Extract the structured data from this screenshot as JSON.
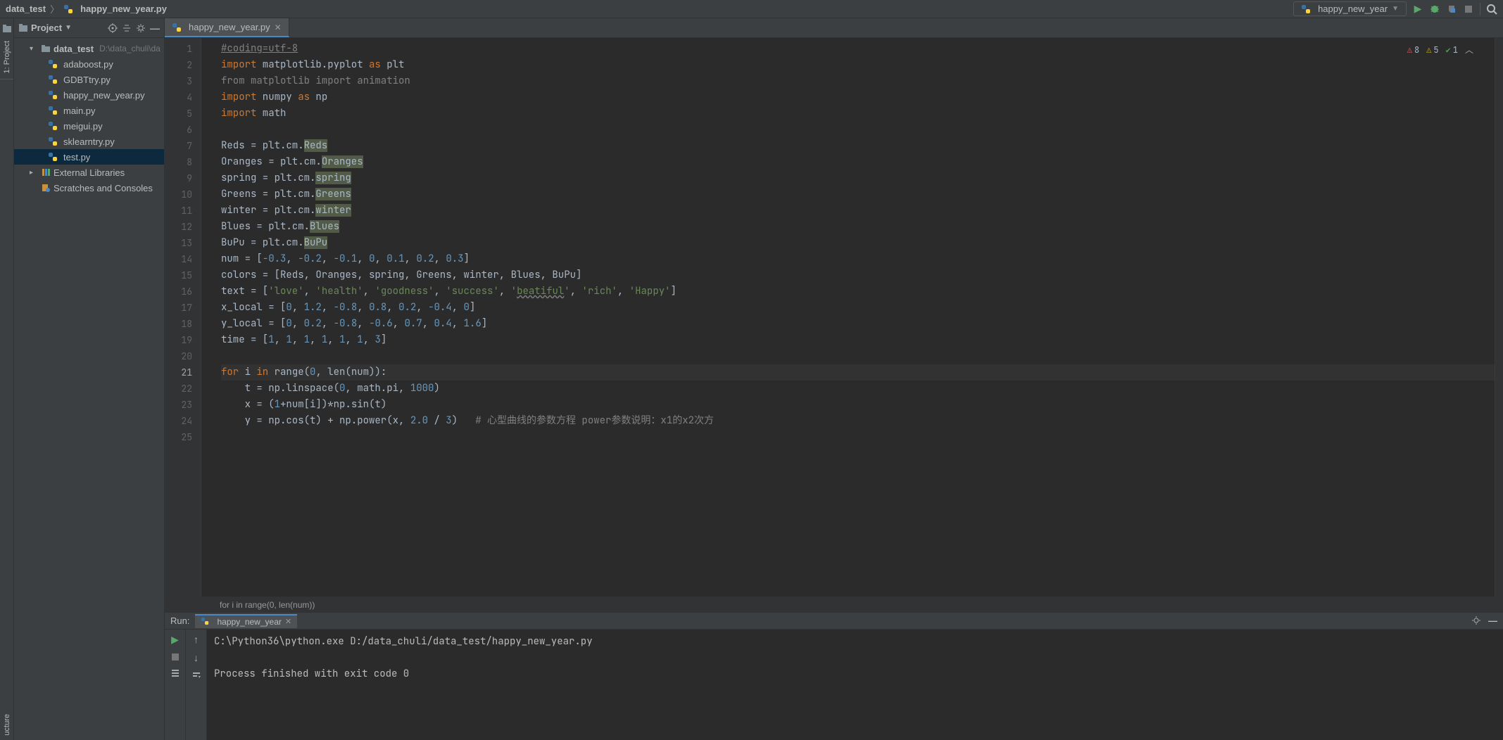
{
  "breadcrumb": {
    "root": "data_test",
    "file": "happy_new_year.py"
  },
  "run_config": {
    "name": "happy_new_year"
  },
  "toolbar": {
    "run": "▶",
    "debug": "🐞"
  },
  "sidebar": {
    "vtab_project": "1: Project",
    "vtab_structure": "ucture"
  },
  "project_panel": {
    "title": "Project",
    "root": {
      "name": "data_test",
      "path": "D:\\data_chuli\\da"
    },
    "files": [
      "adaboost.py",
      "GDBTtry.py",
      "happy_new_year.py",
      "main.py",
      "meigui.py",
      "sklearntry.py",
      "test.py"
    ],
    "selected": "test.py",
    "external_libs": "External Libraries",
    "scratches": "Scratches and Consoles"
  },
  "editor_tab": {
    "name": "happy_new_year.py"
  },
  "inspections": {
    "errors": "8",
    "warnings": "5",
    "weak": "1"
  },
  "code": {
    "l1_comment": "#coding=utf-8",
    "l2_kw": "import",
    "l2_rest": " matplotlib.pyplot ",
    "l2_as": "as",
    "l2_alias": " plt",
    "l3": "from matplotlib import animation",
    "l4_kw": "import",
    "l4_rest": " numpy ",
    "l4_as": "as",
    "l4_alias": " np",
    "l5_kw": "import",
    "l5_rest": " math",
    "l7_pre": "Reds = plt.cm.",
    "l7_hl": "Reds",
    "l8_pre": "Oranges = plt.cm.",
    "l8_hl": "Oranges",
    "l9_pre": "spring = plt.cm.",
    "l9_hl": "spring",
    "l10_pre": "Greens = plt.cm.",
    "l10_hl": "Greens",
    "l11_pre": "winter = plt.cm.",
    "l11_hl": "winter",
    "l12_pre": "Blues = plt.cm.",
    "l12_hl": "Blues",
    "l13_pre": "BuPu = plt.cm.",
    "l13_hl": "BuPu",
    "l14_pre": "num = [",
    "l14_n1": "-0.3",
    "l14_n2": "-0.2",
    "l14_n3": "-0.1",
    "l14_n4": "0",
    "l14_n5": "0.1",
    "l14_n6": "0.2",
    "l14_n7": "0.3",
    "l15": "colors = [Reds, Oranges, spring, Greens, winter, Blues, BuPu]",
    "l16_pre": "text = [",
    "l16_s1": "'love'",
    "l16_s2": "'health'",
    "l16_s3": "'goodness'",
    "l16_s4": "'success'",
    "l16_s5_a": "'",
    "l16_s5_b": "beatiful",
    "l16_s5_c": "'",
    "l16_s6": "'rich'",
    "l16_s7": "'Happy'",
    "l17_pre": "x_local = [",
    "l17_n1": "0",
    "l17_n2": "1.2",
    "l17_n3": "-0.8",
    "l17_n4": "0.8",
    "l17_n5": "0.2",
    "l17_n6": "-0.4",
    "l17_n7": "0",
    "l18_pre": "y_local = [",
    "l18_n1": "0",
    "l18_n2": "0.2",
    "l18_n3": "-0.8",
    "l18_n4": "-0.6",
    "l18_n5": "0.7",
    "l18_n6": "0.4",
    "l18_n7": "1.6",
    "l19_pre": "time = [",
    "l19_n1": "1",
    "l19_n2": "1",
    "l19_n3": "1",
    "l19_n4": "1",
    "l19_n5": "1",
    "l19_n6": "1",
    "l19_n7": "3",
    "l21_for": "for",
    "l21_mid": " i ",
    "l21_in": "in",
    "l21_rest": " range(",
    "l21_z": "0",
    "l21_close": ", len(num)):",
    "l22_pre": "    t = np.linspace(",
    "l22_n1": "0",
    "l22_mid": ", math.pi, ",
    "l22_n2": "1000",
    "l22_end": ")",
    "l23_pre": "    x = (",
    "l23_n1": "1",
    "l23_rest": "+num[i])*np.sin(t)",
    "l24_pre": "    y = np.cos(t) + np.power(x, ",
    "l24_n1": "2.0",
    "l24_mid": " / ",
    "l24_n2": "3",
    "l24_end": ")   ",
    "l24_cmt": "# 心型曲线的参数方程 power参数说明：x1的x2次方"
  },
  "breadcrumb_bottom": "for i in range(0, len(num))",
  "run_panel": {
    "label": "Run:",
    "tab": "happy_new_year",
    "console_line1": "C:\\Python36\\python.exe D:/data_chuli/data_test/happy_new_year.py",
    "console_line2": "Process finished with exit code 0"
  }
}
